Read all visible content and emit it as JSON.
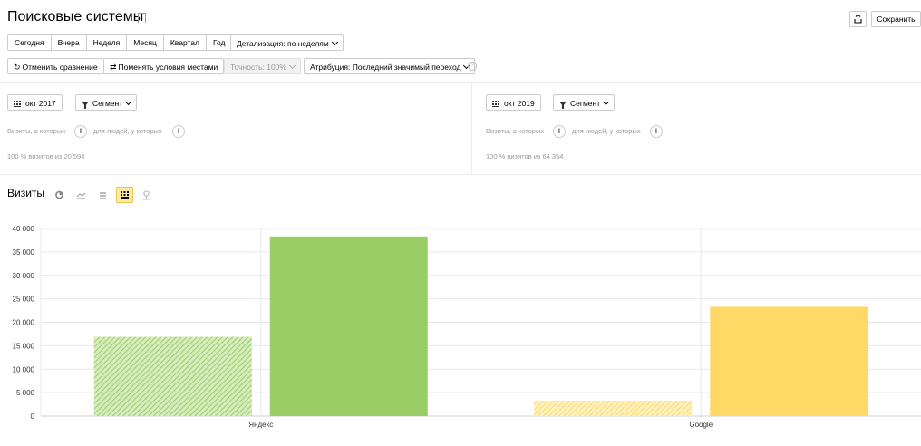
{
  "header": {
    "title": "Поисковые системы",
    "save_label": "Сохранить",
    "share_icon": "share-icon"
  },
  "periods": [
    "Сегодня",
    "Вчера",
    "Неделя",
    "Месяц",
    "Квартал",
    "Год"
  ],
  "detail_label": "Детализация: по неделям",
  "toolbar": {
    "cancel_compare": "Отменить сравнение",
    "swap_conditions": "Поменять условия местами",
    "accuracy": "Точность: 100%",
    "attribution": "Атрибуция: Последний значимый переход"
  },
  "segments": [
    {
      "date": "окт 2017",
      "segment_label": "Сегмент",
      "visits_where": "Визиты, в которых",
      "people_who": "для людей, у которых",
      "summary": "100 % визитов из 20 594"
    },
    {
      "date": "окт 2019",
      "segment_label": "Сегмент",
      "visits_where": "Визиты, в которых",
      "people_who": "для людей, у которых",
      "summary": "100 % визитов из 64 354"
    }
  ],
  "visits": {
    "title": "Визиты"
  },
  "chart_data": {
    "type": "bar",
    "categories": [
      "Яндекс",
      "Google"
    ],
    "series": [
      {
        "period": "окт 2017",
        "values": [
          16900,
          3300
        ]
      },
      {
        "period": "окт 2019",
        "values": [
          38300,
          23300
        ]
      }
    ],
    "colors": {
      "Яндекс": "#9acd66",
      "Google": "#ffd966"
    },
    "ylim": [
      0,
      40000
    ],
    "yticks": [
      "0",
      "5 000",
      "10 000",
      "15 000",
      "20 000",
      "25 000",
      "30 000",
      "35 000",
      "40 000"
    ]
  }
}
